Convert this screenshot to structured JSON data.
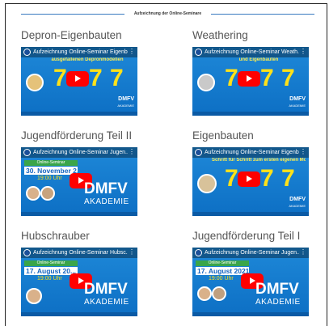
{
  "header": {
    "text": "Aufzeichnung der Online-Seminare"
  },
  "tiles": [
    {
      "title": "Depron-Eigenbauten",
      "video_title": "Aufzeichnung Online-Seminar Eigenb...",
      "subtitle": "ausgefallenen Depronmodellen",
      "brand": "DMFV",
      "brand_sub": "AKADEMIE"
    },
    {
      "title": "Weathering",
      "video_title": "Aufzeichnung Online-Seminar Weath...",
      "subtitle": "und Eigenbauten",
      "brand": "DMFV",
      "brand_sub": "AKADEMIE"
    },
    {
      "title": "Jugendförderung Teil II",
      "video_title": "Aufzeichnung Online-Seminar Jugen...",
      "badge": "Online-Seminar",
      "date": "30. November 2...",
      "time": "19:00 Uhr",
      "brand": "DMFV",
      "brand_sub": "AKADEMIE"
    },
    {
      "title": "Eigenbauten",
      "video_title": "Aufzeichnung Online-Seminar Eigenb...",
      "subtitle": "Schritt für Schritt zum ersten eigenen Modell",
      "brand": "DMFV",
      "brand_sub": "AKADEMIE"
    },
    {
      "title": "Hubschrauber",
      "video_title": "Aufzeichnung Online-Seminar Hubsc...",
      "badge": "Online-Seminar",
      "date": "17. August 20...",
      "time": "19:00 Uhr",
      "brand": "DMFV",
      "brand_sub": "AKADEMIE"
    },
    {
      "title": "Jugendförderung Teil I",
      "video_title": "Aufzeichnung Online-Seminar Jugen...",
      "badge": "Online-Seminar",
      "date": "17. August 2021",
      "time": "19:00 Uhr",
      "brand": "DMFV",
      "brand_sub": "AKADEMIE"
    }
  ]
}
